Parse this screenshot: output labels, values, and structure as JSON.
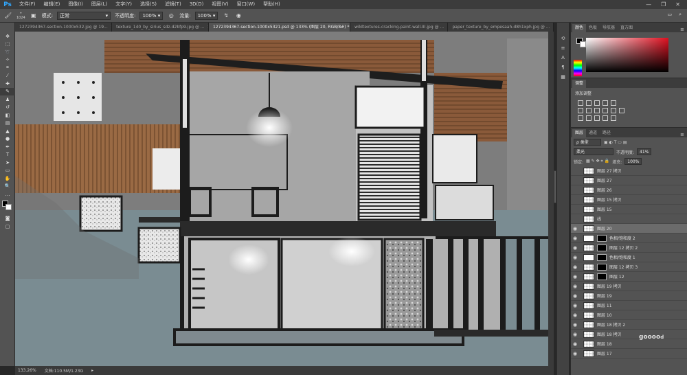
{
  "app": {
    "logo": "Ps"
  },
  "menu": [
    "文件(F)",
    "编辑(E)",
    "图像(I)",
    "图层(L)",
    "文字(Y)",
    "选择(S)",
    "滤镜(T)",
    "3D(D)",
    "视图(V)",
    "窗口(W)",
    "帮助(H)"
  ],
  "options": {
    "brush_size": "1024",
    "mode_label": "模式:",
    "mode_value": "正常",
    "opacity_label": "不透明度:",
    "opacity_value": "100%",
    "flow_label": "流量:",
    "flow_value": "100%"
  },
  "tabs": [
    {
      "label": "1272394367-section-1000x532.jpg @ 19...",
      "active": false
    },
    {
      "label": "texture_140_by_sirius_sdz-d2bfp9.jpg @ ...",
      "active": false
    },
    {
      "label": "1272394367-section-1000x5321.psd @ 133% (图层 20, RGB/8#) *",
      "active": true
    },
    {
      "label": "wildtextures-cracking-paint-wall-III.jpg @ ...",
      "active": false
    },
    {
      "label": "paper_texture_by_empesaah-d8h1xph.jpg @ ...",
      "active": false
    }
  ],
  "status": {
    "zoom": "133.26%",
    "doc": "文档:110.5M/1.23G"
  },
  "panels": {
    "color_tabs": [
      "颜色",
      "色板",
      "导航器",
      "直方图"
    ],
    "adjust_tab": "调整",
    "adjust_add": "添加调整",
    "layer_tabs": [
      "图层",
      "通道",
      "路径"
    ],
    "filter_kind": "ρ 类型",
    "blend_mode": "柔光",
    "opacity_label": "不透明度:",
    "opacity_value": "41%",
    "lock_label": "锁定:",
    "fill_label": "填充:",
    "fill_value": "100%"
  },
  "layers": [
    {
      "name": "图层 27 拷贝",
      "visible": false,
      "selected": false,
      "type": "normal"
    },
    {
      "name": "图层 27",
      "visible": false,
      "selected": false,
      "type": "normal"
    },
    {
      "name": "图层 26",
      "visible": false,
      "selected": false,
      "type": "normal"
    },
    {
      "name": "图层 15 拷贝",
      "visible": false,
      "selected": false,
      "type": "normal"
    },
    {
      "name": "图层 15",
      "visible": false,
      "selected": false,
      "type": "normal"
    },
    {
      "name": "线",
      "visible": false,
      "selected": false,
      "type": "normal"
    },
    {
      "name": "图层 20",
      "visible": true,
      "selected": true,
      "type": "normal"
    },
    {
      "name": "色相/饱和度 2",
      "visible": true,
      "selected": false,
      "type": "adj"
    },
    {
      "name": "图层 12 拷贝 2",
      "visible": true,
      "selected": false,
      "type": "mask"
    },
    {
      "name": "色相/饱和度 1",
      "visible": true,
      "selected": false,
      "type": "adj"
    },
    {
      "name": "图层 12 拷贝 3",
      "visible": true,
      "selected": false,
      "type": "mask"
    },
    {
      "name": "图层 12",
      "visible": true,
      "selected": false,
      "type": "mask"
    },
    {
      "name": "图层 19 拷贝",
      "visible": true,
      "selected": false,
      "type": "normal"
    },
    {
      "name": "图层 19",
      "visible": true,
      "selected": false,
      "type": "normal"
    },
    {
      "name": "图层 11",
      "visible": true,
      "selected": false,
      "type": "normal"
    },
    {
      "name": "图层 10",
      "visible": true,
      "selected": false,
      "type": "normal"
    },
    {
      "name": "图层 18 拷贝 2",
      "visible": true,
      "selected": false,
      "type": "normal"
    },
    {
      "name": "图层 18 拷贝",
      "visible": true,
      "selected": false,
      "type": "normal"
    },
    {
      "name": "图层 18",
      "visible": true,
      "selected": false,
      "type": "normal"
    },
    {
      "name": "图层 17",
      "visible": true,
      "selected": false,
      "type": "normal"
    }
  ],
  "watermark": "gooood"
}
